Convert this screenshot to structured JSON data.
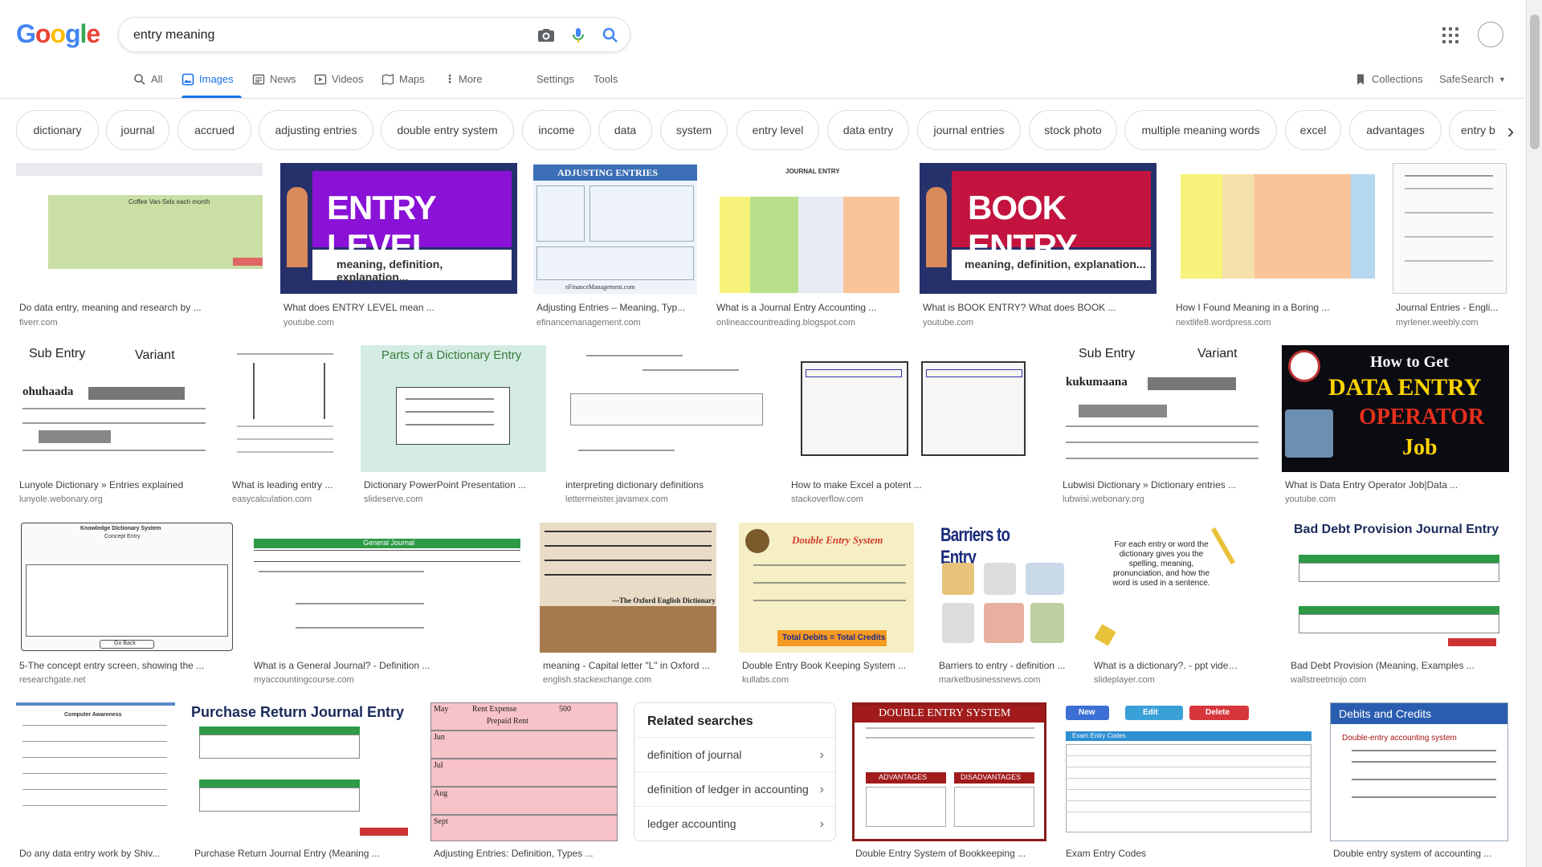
{
  "search": {
    "query": "entry meaning",
    "logo": [
      "G",
      "o",
      "o",
      "g",
      "l",
      "e"
    ],
    "logo_colors": [
      "#4285f4",
      "#ea4335",
      "#fbbc05",
      "#4285f4",
      "#34a853",
      "#ea4335"
    ]
  },
  "tabs": [
    {
      "label": "All",
      "icon": "search-icon"
    },
    {
      "label": "Images",
      "icon": "image-icon",
      "active": true
    },
    {
      "label": "News",
      "icon": "news-icon"
    },
    {
      "label": "Videos",
      "icon": "video-icon"
    },
    {
      "label": "Maps",
      "icon": "map-icon"
    },
    {
      "label": "More",
      "icon": "more-vert-icon"
    },
    {
      "label": "Settings"
    },
    {
      "label": "Tools"
    }
  ],
  "header_right": {
    "collections": "Collections",
    "safesearch": "SafeSearch"
  },
  "chips": [
    "dictionary",
    "journal",
    "accrued",
    "adjusting entries",
    "double entry system",
    "income",
    "data",
    "system",
    "entry level",
    "data entry",
    "journal entries",
    "stock photo",
    "multiple meaning words",
    "excel",
    "advantages",
    "entry b"
  ],
  "results": [
    {
      "caption": "Do data entry, meaning and research by ...",
      "source": "fiverr.com"
    },
    {
      "caption": "What does ENTRY LEVEL mean ...",
      "source": "youtube.com"
    },
    {
      "caption": "Adjusting Entries – Meaning, Typ...",
      "source": "efinancemanagement.com"
    },
    {
      "caption": "What is a Journal Entry Accounting ...",
      "source": "onlineaccountreading.blogspot.com"
    },
    {
      "caption": "What is BOOK ENTRY? What does BOOK ...",
      "source": "youtube.com"
    },
    {
      "caption": "How I Found Meaning in a Boring ...",
      "source": "nextlife8.wordpress.com"
    },
    {
      "caption": "Journal Entries - Engli...",
      "source": "myrlener.weebly.com"
    },
    {
      "caption": "Lunyole Dictionary » Entries explained",
      "source": "lunyole.webonary.org"
    },
    {
      "caption": "What is leading entry ...",
      "source": "easycalculation.com"
    },
    {
      "caption": "Dictionary PowerPoint Presentation ...",
      "source": "slideserve.com"
    },
    {
      "caption": "interpreting dictionary definitions",
      "source": "lettermeister.javamex.com"
    },
    {
      "caption": "How to make Excel a potent ...",
      "source": "stackoverflow.com"
    },
    {
      "caption": "Lubwisi Dictionary » Dictionary entries ...",
      "source": "lubwisi.webonary.org"
    },
    {
      "caption": "What is Data Entry Operator Job|Data ...",
      "source": "youtube.com"
    },
    {
      "caption": "5-The concept entry screen, showing the ...",
      "source": "researchgate.net"
    },
    {
      "caption": "What is a General Journal? - Definition ...",
      "source": "myaccountingcourse.com"
    },
    {
      "caption": "meaning - Capital letter \"L\" in Oxford ...",
      "source": "english.stackexchange.com"
    },
    {
      "caption": "Double Entry Book Keeping System ...",
      "source": "kullabs.com"
    },
    {
      "caption": "Barriers to entry - definition ...",
      "source": "marketbusinessnews.com"
    },
    {
      "caption": "What is a dictionary?. - ppt video ...",
      "source": "slideplayer.com"
    },
    {
      "caption": "Bad Debt Provision (Meaning, Examples ...",
      "source": "wallstreetmojo.com"
    },
    {
      "caption": "Do any data entry work by Shiv...",
      "source": ""
    },
    {
      "caption": "Purchase Return Journal Entry (Meaning ...",
      "source": ""
    },
    {
      "caption": "Adjusting Entries: Definition, Types ...",
      "source": ""
    },
    {
      "caption": "Double Entry System of Bookkeeping ...",
      "source": ""
    },
    {
      "caption": "Exam Entry Codes",
      "source": ""
    },
    {
      "caption": "Double entry system of accounting ...",
      "source": ""
    }
  ],
  "thumb_text": {
    "entry_level_big": "ENTRY LEVEL",
    "entry_level_sub": "meaning, definition, explanation...",
    "book_entry_big": "BOOK ENTRY",
    "book_entry_sub": "meaning, definition, explanation...",
    "adjusting_title": "ADJUSTING ENTRIES",
    "adjusting_footer": "eFinanceManagement.com",
    "journal_entry_title": "JOURNAL ENTRY",
    "sub_entry": "Sub Entry",
    "variant": "Variant",
    "lunyole_word": "ohuhaada",
    "lubwisi_word": "kukumaana",
    "dict_title": "Parts of a Dictionary Entry",
    "data_entry_1": "How to Get",
    "data_entry_2": "DATA ENTRY",
    "data_entry_3": "OPERATOR",
    "data_entry_4": "Job",
    "general_journal": "General Journal",
    "double_entry_system": "Double Entry System",
    "total_formula": "Total Debits = Total Credits",
    "barriers": "Barriers to Entry",
    "dictionary_sentence": "For each entry or word the dictionary gives you the spelling, meaning, pronunciation, and how the word is used in a sentence.",
    "bad_debt_title": "Bad Debt Provision Journal Entry",
    "purchase_return_title": "Purchase Return Journal Entry",
    "double_entry_banner": "DOUBLE ENTRY SYSTEM",
    "advantages": "ADVANTAGES",
    "disadvantages": "DISADVANTAGES",
    "exam_entry_codes": "Exam Entry Codes",
    "new_btn": "New",
    "edit_btn": "Edit",
    "delete_btn": "Delete",
    "debits_credits": "Debits and Credits",
    "debits_credits_sub": "Double-entry accounting system",
    "computer_awareness": "Computer Awareness",
    "coffee_title": "Coffee Van-Sels each month",
    "knowledge_title": "Knowledge Dictionary System",
    "concept_entry": "Concept Entry",
    "go_back": "Go Back",
    "oxford_quote": "—The Oxford English Dictionary",
    "rent_expense": "Rent Expense",
    "prepaid_rent": "Prepaid Rent",
    "months": [
      "May",
      "Jun",
      "Jul",
      "Aug",
      "Sept"
    ],
    "amount": "500"
  },
  "related": {
    "title": "Related searches",
    "items": [
      "definition of journal",
      "definition of ledger in accounting",
      "ledger accounting"
    ]
  },
  "colors": {
    "accent": "#1a73e8",
    "purple": "#8a12d6",
    "crimson": "#c2143e"
  }
}
